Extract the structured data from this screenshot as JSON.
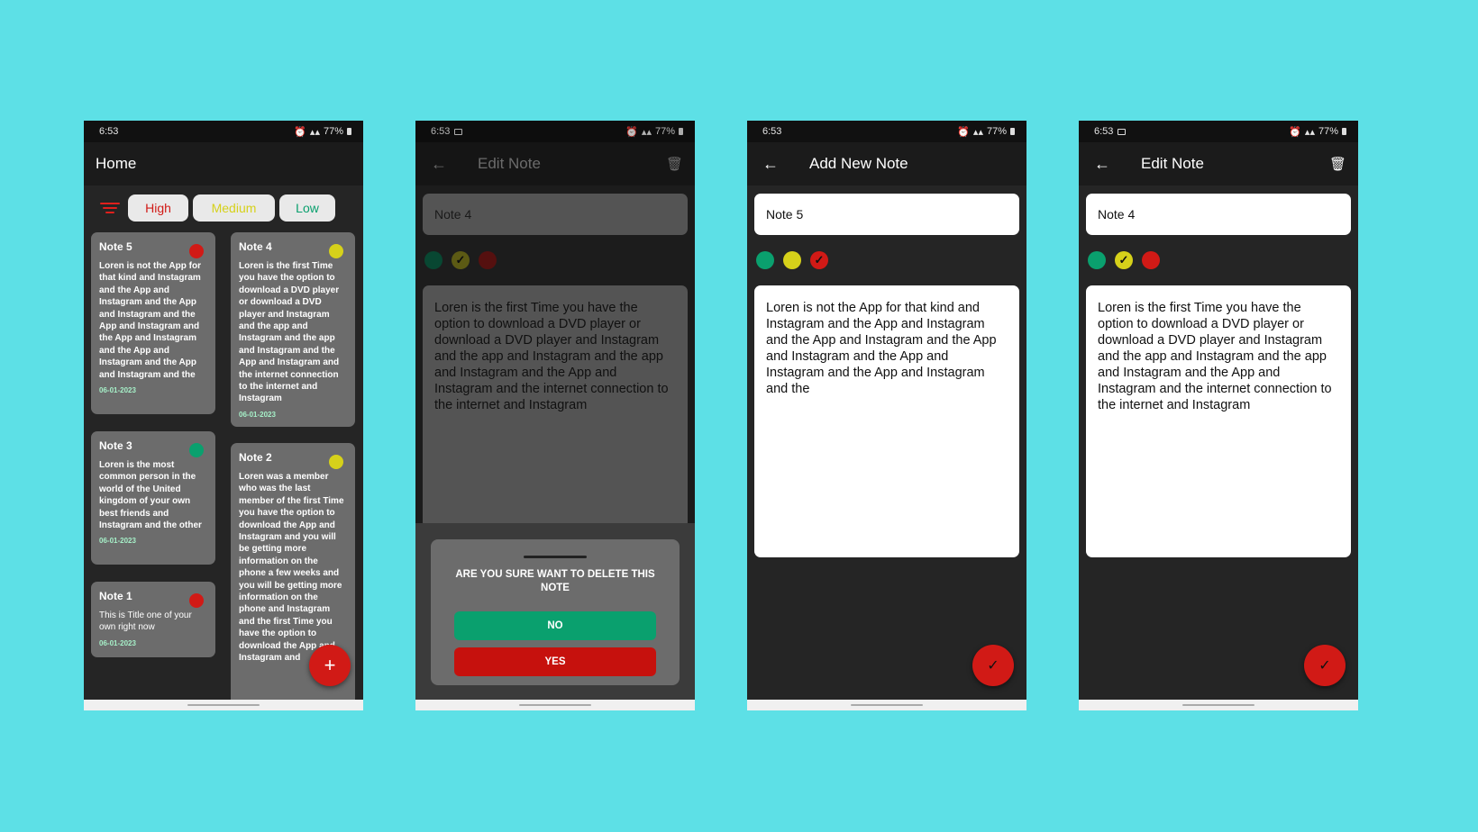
{
  "colors": {
    "background": "#5de0e6",
    "high": "#d11a16",
    "medium": "#d6d11a",
    "low": "#0aa06e",
    "card": "#6c6c6c",
    "date": "#a6f0c8"
  },
  "icons": {
    "filter": "filter-icon",
    "back": "←",
    "trash": "🗑",
    "plus": "+",
    "check": "✓"
  },
  "screens": {
    "home": {
      "status": {
        "time": "6:53",
        "battery": "77%"
      },
      "title": "Home",
      "filters": {
        "high": "High",
        "medium": "Medium",
        "low": "Low"
      },
      "notes": [
        {
          "title": "Note 5",
          "body": "Loren is not the App for that kind and Instagram and the App and Instagram and the App and Instagram and the App and Instagram and the App and Instagram and the App and Instagram and the App and Instagram and the",
          "date": "06-01-2023",
          "priority": "high"
        },
        {
          "title": "Note 4",
          "body": "Loren is the first Time you have the option to download a DVD player or download a DVD player and Instagram and the app and Instagram and the app and Instagram and the App and Instagram and the internet connection to the internet and Instagram",
          "date": "06-01-2023",
          "priority": "medium"
        },
        {
          "title": "Note 3",
          "body": "Loren is the most common person in the world of the United kingdom of your own best friends and Instagram and the other",
          "date": "06-01-2023",
          "priority": "low"
        },
        {
          "title": "Note 2",
          "body": "Loren was a member who was the last member of the first Time you have the option to download the App and Instagram and you will be getting more information on the phone a few weeks and you will be getting more information on the phone and Instagram and the first Time you have the option to download the App and Instagram and",
          "date": "",
          "priority": "medium"
        },
        {
          "title": "Note 1",
          "body": "This is Title one of your own right now",
          "date": "06-01-2023",
          "priority": "high"
        }
      ]
    },
    "edit_delete": {
      "status": {
        "time": "6:53",
        "battery": "77%"
      },
      "title": "Edit Note",
      "note_title": "Note 4",
      "note_body": "Loren is the first Time you have the option to download a DVD player or download a DVD player and Instagram and the app and Instagram and the app and Instagram and the App and Instagram and the internet connection to the internet and Instagram",
      "selected_priority": "medium",
      "dialog": {
        "question": "ARE YOU SURE WANT TO DELETE THIS NOTE",
        "no": "NO",
        "yes": "YES"
      }
    },
    "add": {
      "status": {
        "time": "6:53",
        "battery": "77%"
      },
      "title": "Add New Note",
      "note_title": "Note 5",
      "note_body": "Loren is not the App for that kind and Instagram and the App and Instagram and the App and Instagram and the App and Instagram and the App and Instagram and the App and Instagram and the",
      "selected_priority": "high"
    },
    "edit": {
      "status": {
        "time": "6:53",
        "battery": "77%"
      },
      "title": "Edit Note",
      "note_title": "Note 4",
      "note_body": "Loren is the first Time you have the option to download a DVD player or download a DVD player and Instagram and the app and Instagram and the app and Instagram and the App and Instagram and the internet connection to the internet and Instagram",
      "selected_priority": "medium"
    }
  }
}
